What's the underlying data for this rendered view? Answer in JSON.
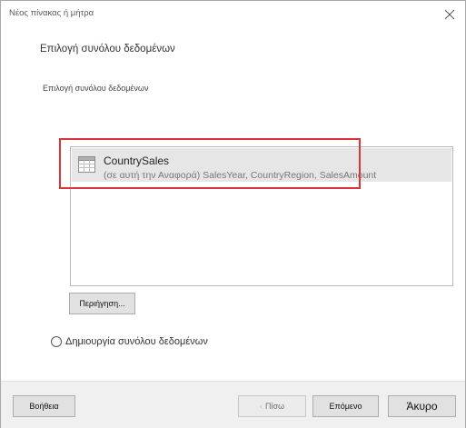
{
  "dialog": {
    "title": "Νέος πίνακας ή μήτρα",
    "heading": "Επιλογή συνόλου δεδομένων",
    "subheading": "Επιλογή συνόλου δεδομένων"
  },
  "datasets": [
    {
      "name": "CountrySales",
      "description": "(σε αυτή την Αναφορά) SalesYear, CountryRegion, SalesAmount",
      "icon": "table-icon",
      "selected": true
    }
  ],
  "buttons": {
    "browse": "Περιήγηση...",
    "help": "Βοήθεια",
    "back": "Πίσω",
    "next": "Επόμενο",
    "cancel": "Άκυρο"
  },
  "create_dataset": {
    "label": "Δημιουργία συνόλου δεδομένων",
    "checked": false
  },
  "colors": {
    "highlight": "#d9353a",
    "selected_row": "#e6e6e6",
    "footer": "#f0f0f0"
  }
}
